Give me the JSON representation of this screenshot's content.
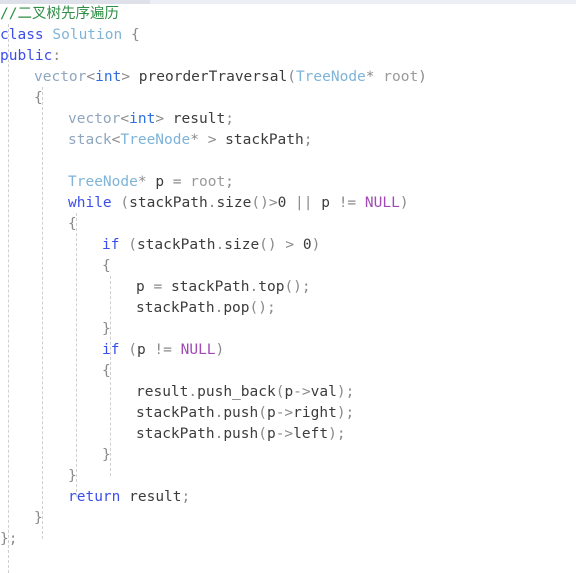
{
  "editor": {
    "language": "cpp",
    "background": "#ffffff",
    "indent_guide_color": "#cfcfcf",
    "scrollbar": {
      "track_color": "#eceef5",
      "thumb_color": "#dfe1ea"
    },
    "colors": {
      "keyword": "#3b4ee8",
      "container_type": "#8fa6bf",
      "primitive_type": "#2f6fe0",
      "class_name": "#7fb4d8",
      "macro_null": "#a14ab5",
      "parameter": "#9a9a9a",
      "comment": "#2f8f46",
      "punctuation": "#8a8a8a",
      "identifier": "#3c3c3c"
    },
    "font_size_px": 14.5,
    "line_height_px": 21,
    "total_lines": 28
  },
  "code": {
    "lines": [
      {
        "n": 1,
        "indent": 0,
        "text": "//二叉树先序遍历"
      },
      {
        "n": 2,
        "indent": 0,
        "text": "class Solution {"
      },
      {
        "n": 3,
        "indent": 0,
        "text": "public:"
      },
      {
        "n": 4,
        "indent": 1,
        "text": "vector<int> preorderTraversal(TreeNode* root)"
      },
      {
        "n": 5,
        "indent": 1,
        "text": "{"
      },
      {
        "n": 6,
        "indent": 2,
        "text": "vector<int> result;"
      },
      {
        "n": 7,
        "indent": 2,
        "text": "stack<TreeNode* > stackPath;"
      },
      {
        "n": 8,
        "indent": 2,
        "text": ""
      },
      {
        "n": 9,
        "indent": 2,
        "text": "TreeNode* p = root;"
      },
      {
        "n": 10,
        "indent": 2,
        "text": "while (stackPath.size()>0 || p != NULL)"
      },
      {
        "n": 11,
        "indent": 2,
        "text": "{"
      },
      {
        "n": 12,
        "indent": 3,
        "text": "if (stackPath.size() > 0)"
      },
      {
        "n": 13,
        "indent": 3,
        "text": "{"
      },
      {
        "n": 14,
        "indent": 4,
        "text": "p = stackPath.top();"
      },
      {
        "n": 15,
        "indent": 4,
        "text": "stackPath.pop();"
      },
      {
        "n": 16,
        "indent": 3,
        "text": "}"
      },
      {
        "n": 17,
        "indent": 3,
        "text": "if (p != NULL)"
      },
      {
        "n": 18,
        "indent": 3,
        "text": "{"
      },
      {
        "n": 19,
        "indent": 4,
        "text": "result.push_back(p->val);"
      },
      {
        "n": 20,
        "indent": 4,
        "text": "stackPath.push(p->right);"
      },
      {
        "n": 21,
        "indent": 4,
        "text": "stackPath.push(p->left);"
      },
      {
        "n": 22,
        "indent": 3,
        "text": "}"
      },
      {
        "n": 23,
        "indent": 2,
        "text": "}"
      },
      {
        "n": 24,
        "indent": 2,
        "text": "return result;"
      },
      {
        "n": 25,
        "indent": 1,
        "text": "}"
      },
      {
        "n": 26,
        "indent": 0,
        "text": "};"
      }
    ],
    "tokens": {
      "comment_line": "//二叉树先序遍历",
      "keywords": [
        "class",
        "public",
        "while",
        "if",
        "return"
      ],
      "types": [
        "vector",
        "stack",
        "int",
        "TreeNode"
      ],
      "class_name": "Solution",
      "function_name": "preorderTraversal",
      "parameter": "root",
      "variables": [
        "result",
        "stackPath",
        "p"
      ],
      "members": [
        "size",
        "top",
        "pop",
        "push_back",
        "push",
        "val",
        "right",
        "left"
      ],
      "macros": [
        "NULL"
      ]
    }
  }
}
